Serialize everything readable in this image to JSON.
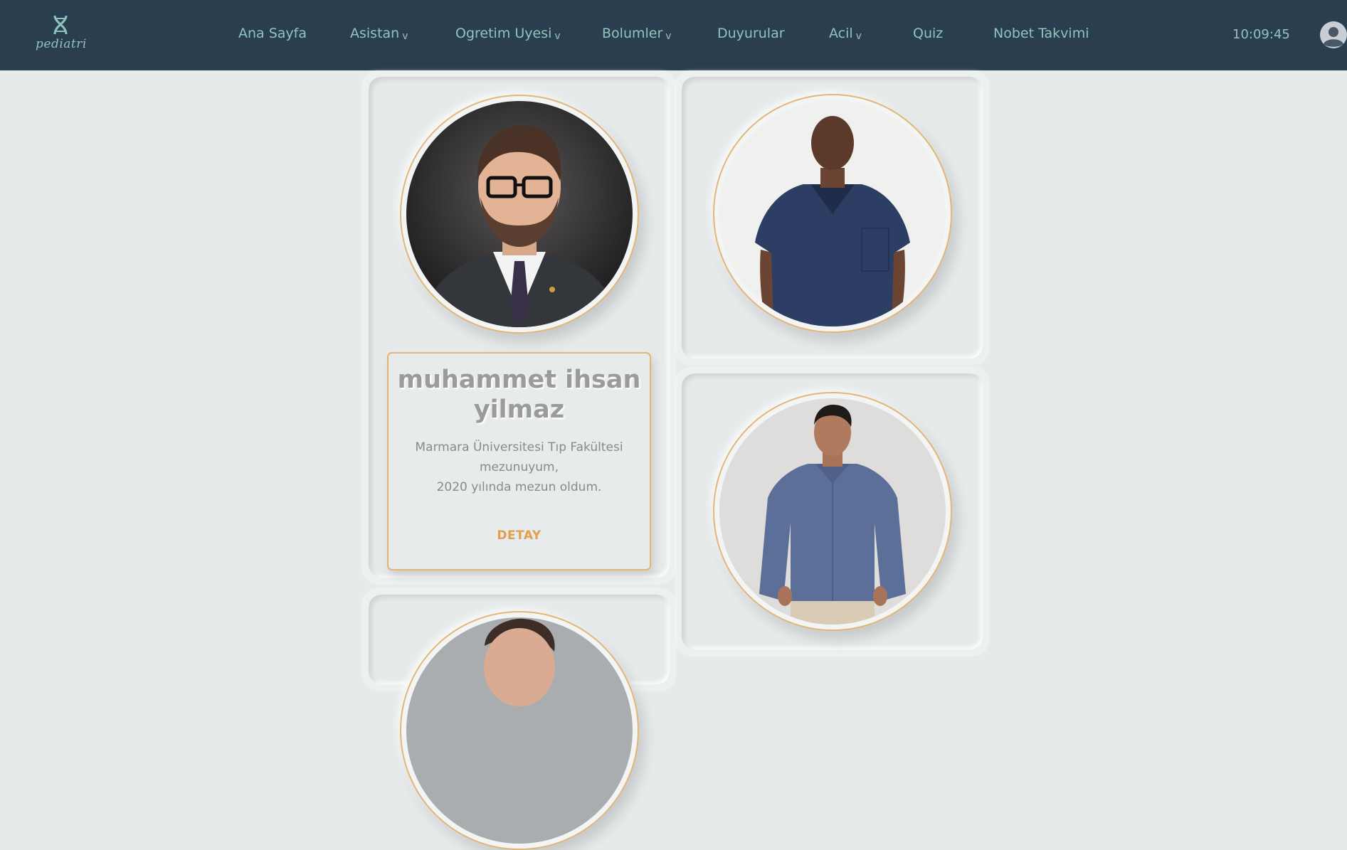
{
  "navbar": {
    "logo_text": "pediatri",
    "items": [
      {
        "label": "Ana Sayfa",
        "caret": ""
      },
      {
        "label": "Asistan",
        "caret": "v"
      },
      {
        "label": "Ogretim Uyesi",
        "caret": "v"
      },
      {
        "label": "Bolumler",
        "caret": "v"
      },
      {
        "label": "Duyurular",
        "caret": ""
      },
      {
        "label": "Acil",
        "caret": "v"
      },
      {
        "label": "Quiz",
        "caret": ""
      },
      {
        "label": "Nobet Takvimi",
        "caret": ""
      }
    ],
    "clock": "10:09:45"
  },
  "cards": {
    "featured": {
      "name": "muhammet ihsan yilmaz",
      "bio_line1": "Marmara Üniversitesi Tıp Fakültesi",
      "bio_line2": "mezunuyum,",
      "bio_line3": "2020 yılında mezun oldum.",
      "detail_label": "DETAY"
    }
  },
  "colors": {
    "navbar_bg": "#2b3e4f",
    "nav_text": "#8fc4bd",
    "page_bg": "#e6eaea",
    "accent_gold": "#e3b678",
    "detail_orange": "#e0a04e"
  },
  "icons": {
    "logo": "dna-icon",
    "avatar": "user-avatar-icon"
  }
}
